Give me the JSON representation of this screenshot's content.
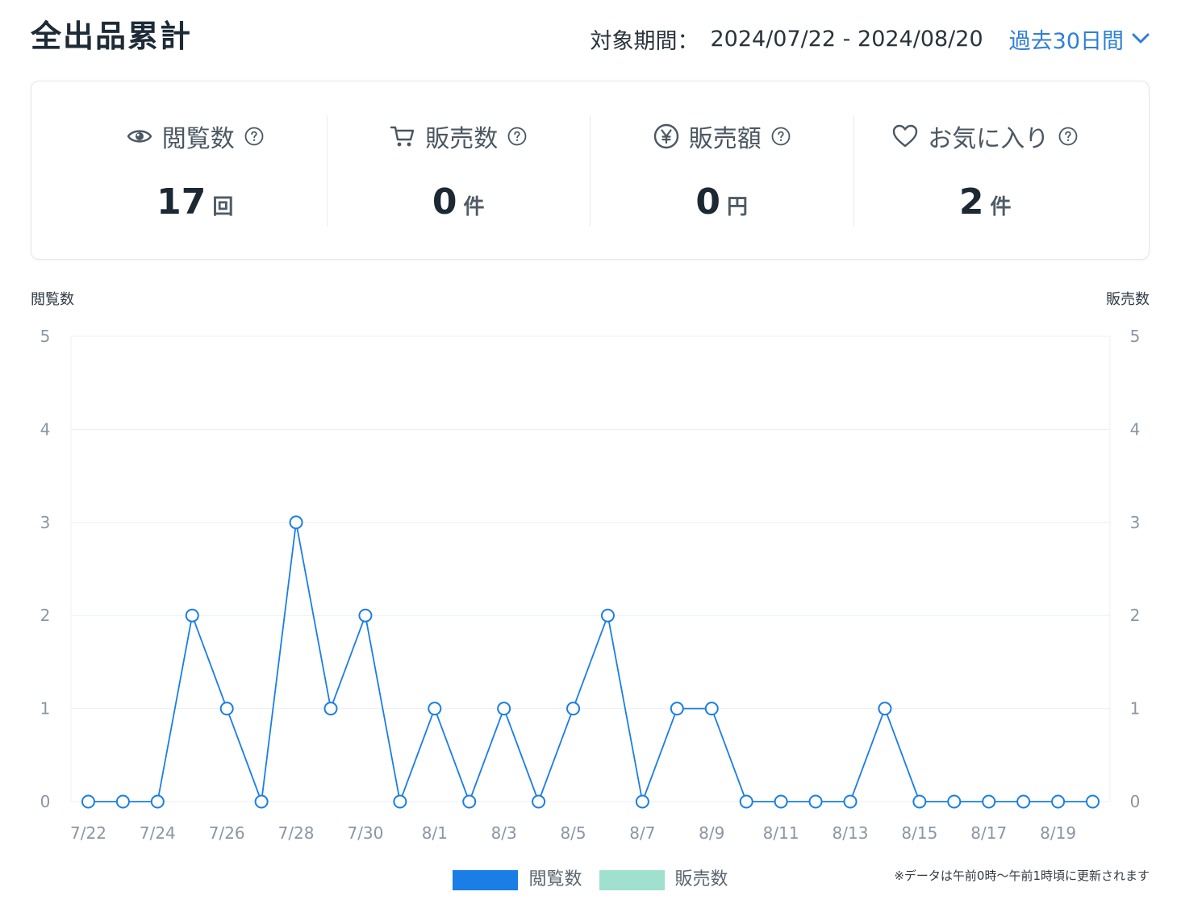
{
  "colors": {
    "accent": "#2e7fd6",
    "text": "#1e2b37",
    "muted": "#4b5762"
  },
  "header": {
    "title": "全出品累計",
    "period_label": "対象期間：",
    "period_range": "2024/07/22 - 2024/08/20",
    "period_select": "過去30日間",
    "period_select_icon": "chevron-down-icon"
  },
  "stats": [
    {
      "icon": "eye-icon",
      "label": "閲覧数",
      "value": "17",
      "unit": "回",
      "help_icon": "question-circle-icon"
    },
    {
      "icon": "cart-icon",
      "label": "販売数",
      "value": "0",
      "unit": "件",
      "help_icon": "question-circle-icon"
    },
    {
      "icon": "yen-circle-icon",
      "label": "販売額",
      "value": "0",
      "unit": "円",
      "help_icon": "question-circle-icon"
    },
    {
      "icon": "heart-icon",
      "label": "お気に入り",
      "value": "2",
      "unit": "件",
      "help_icon": "question-circle-icon"
    }
  ],
  "chart_data": {
    "type": "line",
    "x": [
      "7/22",
      "7/23",
      "7/24",
      "7/25",
      "7/26",
      "7/27",
      "7/28",
      "7/29",
      "7/30",
      "7/31",
      "8/1",
      "8/2",
      "8/3",
      "8/4",
      "8/5",
      "8/6",
      "8/7",
      "8/8",
      "8/9",
      "8/10",
      "8/11",
      "8/12",
      "8/13",
      "8/14",
      "8/15",
      "8/16",
      "8/17",
      "8/18",
      "8/19",
      "8/20"
    ],
    "series": [
      {
        "name": "閲覧数",
        "type": "line",
        "axis": "left",
        "color": "#1a7ee6",
        "values": [
          0,
          0,
          0,
          2,
          1,
          0,
          3,
          1,
          2,
          0,
          1,
          0,
          1,
          0,
          1,
          2,
          0,
          1,
          1,
          0,
          0,
          0,
          0,
          1,
          0,
          0,
          0,
          0,
          0,
          0
        ]
      },
      {
        "name": "販売数",
        "type": "bar",
        "axis": "right",
        "color": "#9fe0cf",
        "values": [
          0,
          0,
          0,
          0,
          0,
          0,
          0,
          0,
          0,
          0,
          0,
          0,
          0,
          0,
          0,
          0,
          0,
          0,
          0,
          0,
          0,
          0,
          0,
          0,
          0,
          0,
          0,
          0,
          0,
          0
        ]
      }
    ],
    "ylabel": "閲覧数",
    "y2label": "販売数",
    "ylim": [
      0,
      5
    ],
    "y2lim": [
      0,
      5
    ],
    "yticks": [
      0,
      1,
      2,
      3,
      4,
      5
    ],
    "y2ticks": [
      0,
      1,
      2,
      3,
      4,
      5
    ],
    "grid": true,
    "legend": "bottom"
  },
  "footnote": "※データは午前0時〜午前1時頃に更新されます"
}
